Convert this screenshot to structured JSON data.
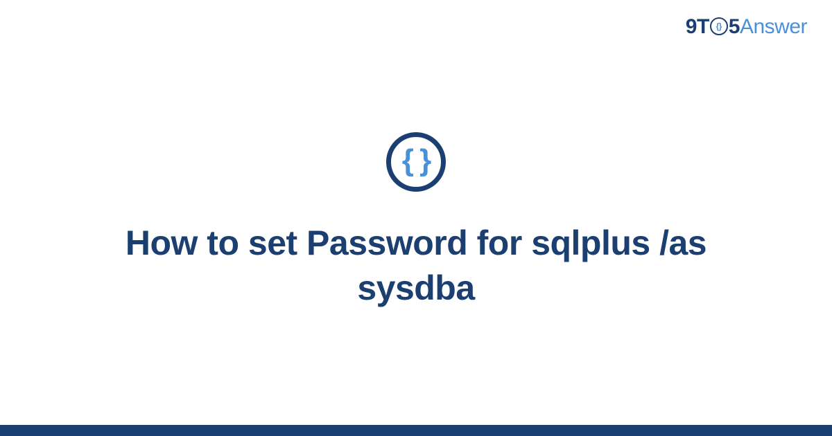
{
  "brand": {
    "nine": "9",
    "t": "T",
    "clock_inner": "{}",
    "five": "5",
    "answer": "Answer"
  },
  "badge": {
    "symbol": "{ }"
  },
  "title": "How to set Password for sqlplus /as sysdba",
  "colors": {
    "primary": "#1c3f72",
    "accent": "#4a90d9"
  }
}
